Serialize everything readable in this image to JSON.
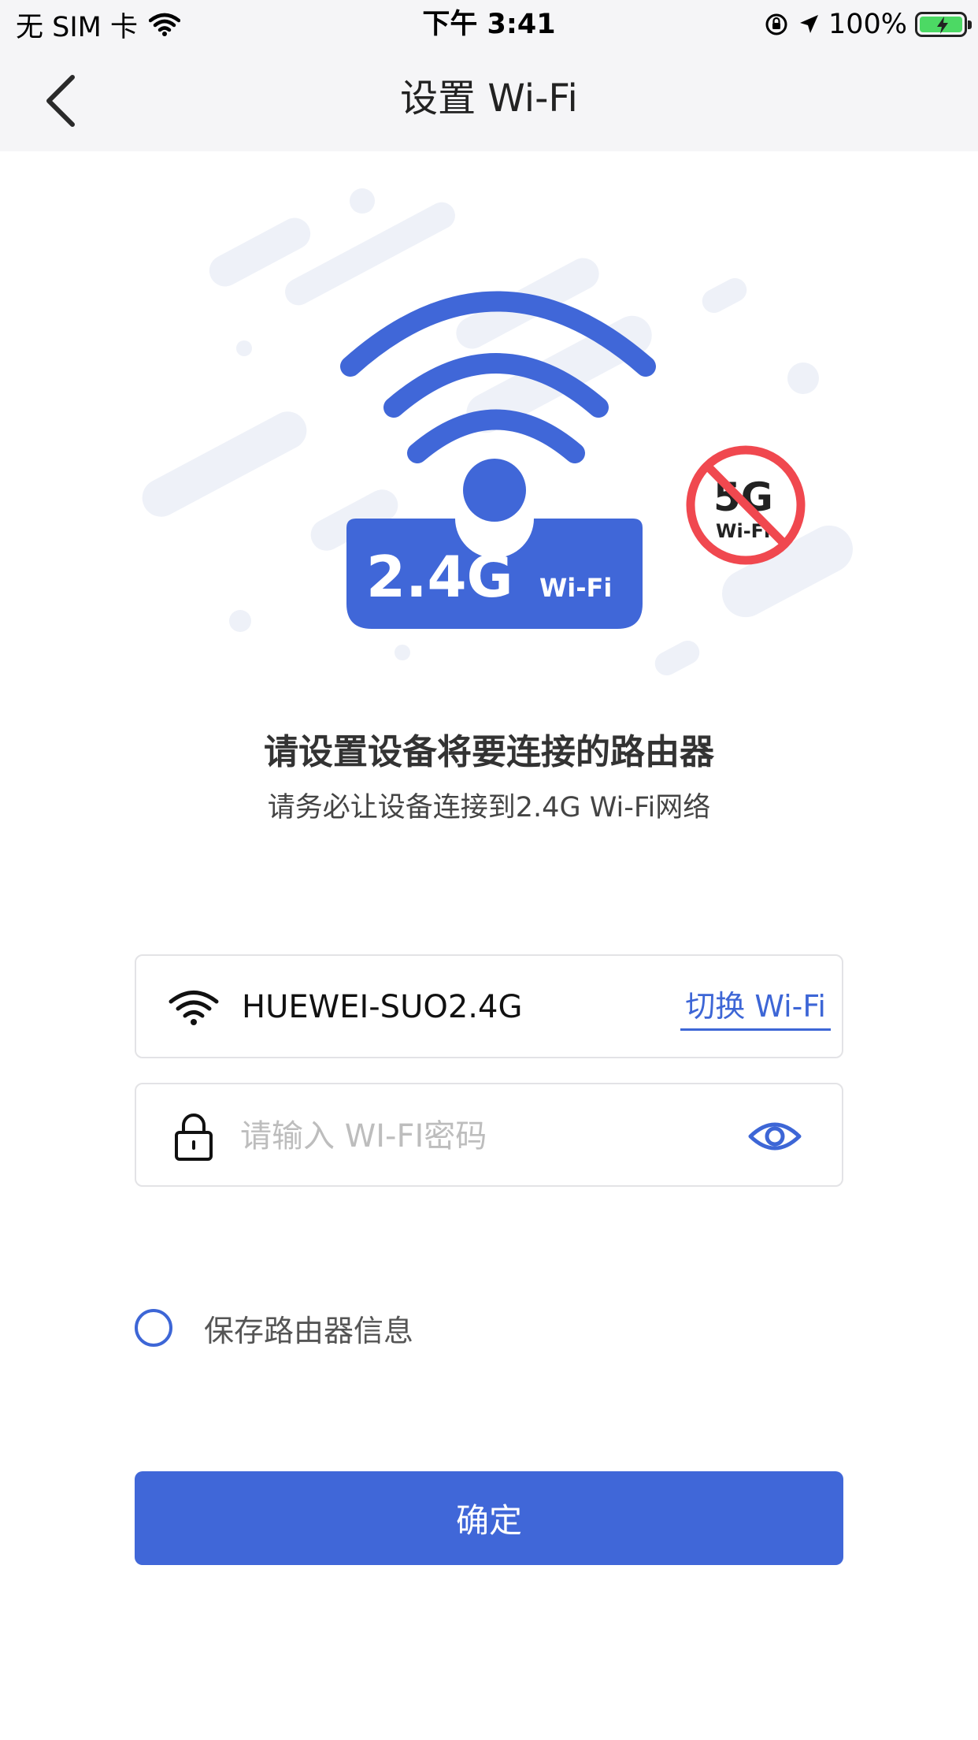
{
  "status_bar": {
    "carrier": "无 SIM 卡",
    "time": "下午 3:41",
    "battery": "100%",
    "wifi_icon": "wifi-icon",
    "rotation_lock_icon": "rotation-lock-icon",
    "location_icon": "location-arrow-icon",
    "battery_icon": "battery-charging-icon"
  },
  "nav": {
    "title": "设置 Wi-Fi",
    "back_icon": "chevron-left-icon"
  },
  "illustration": {
    "badge_band": "2.4G",
    "badge_suffix": "Wi-Fi",
    "prohibited_band": "5G",
    "prohibited_suffix": "Wi-Fi",
    "colors": {
      "primary_blue": "#4067d8",
      "prohibited_red": "#f0484f",
      "background_streaks": "#eef1f8"
    }
  },
  "instructions": {
    "headline": "请设置设备将要连接的路由器",
    "subline": "请务必让设备连接到2.4G Wi-Fi网络"
  },
  "ssid_field": {
    "ssid": "HUEWEI-SUO2.4G",
    "switch_label": "切换 Wi-Fi",
    "icon": "wifi-icon"
  },
  "password_field": {
    "placeholder": "请输入 WI-FI密码",
    "value": "",
    "lock_icon": "lock-icon",
    "visibility_icon": "eye-icon"
  },
  "remember": {
    "label": "保存路由器信息",
    "checked": false
  },
  "confirm": {
    "label": "确定"
  },
  "theme": {
    "accent": "#4067d8",
    "topbar_bg": "#f5f5f7",
    "border": "#e3e3e6"
  }
}
